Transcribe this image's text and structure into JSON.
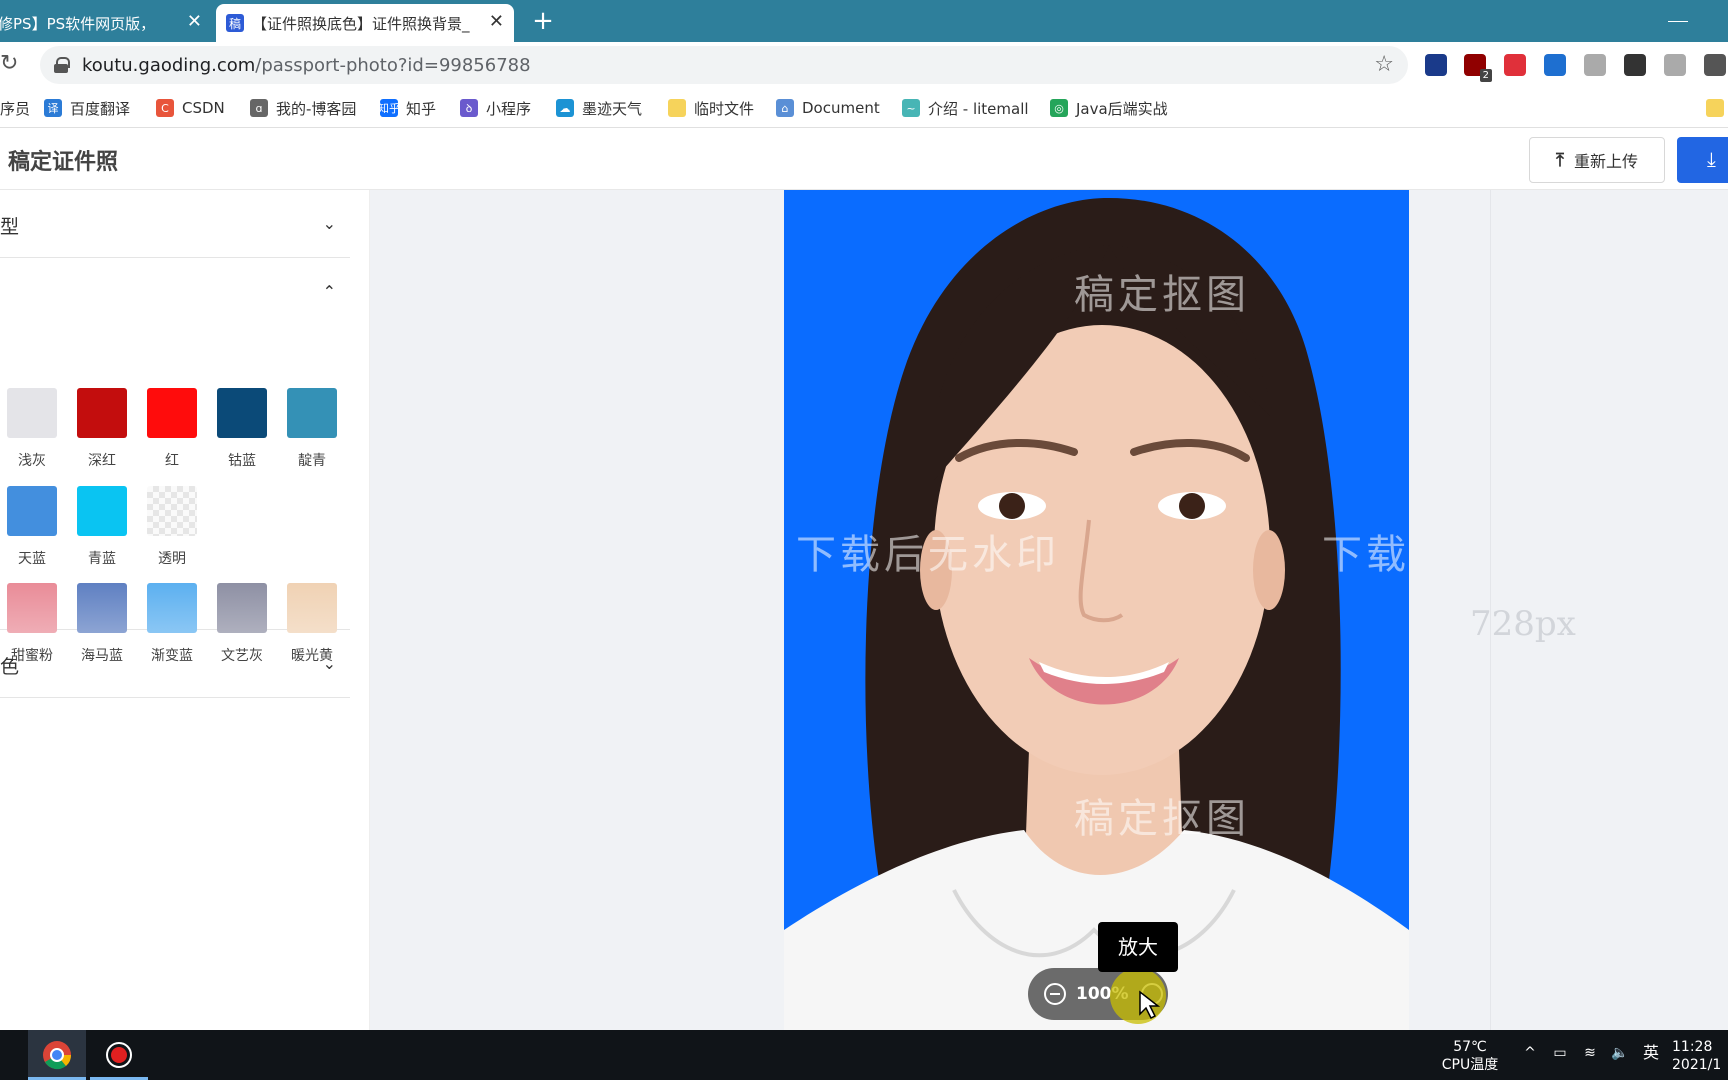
{
  "browser": {
    "tabs": [
      {
        "title": "修PS】PS软件网页版，ps在",
        "active": false
      },
      {
        "title": "【证件照换底色】证件照换背景_",
        "active": true,
        "favicon": "稿"
      }
    ],
    "new_tab": "+",
    "url_host": "koutu.gaoding.com",
    "url_path": "/passport-photo?id=99856788",
    "bookmarks": [
      {
        "label": "序员",
        "icon": "",
        "color": ""
      },
      {
        "label": "百度翻译",
        "icon": "译",
        "color": "#2b7bd6"
      },
      {
        "label": "CSDN",
        "icon": "C",
        "color": "#e8553b"
      },
      {
        "label": "我的-博客园",
        "icon": "ɑ",
        "color": "#666666"
      },
      {
        "label": "知乎",
        "icon": "知乎",
        "color": "#0f6fff"
      },
      {
        "label": "小程序",
        "icon": "ꝺ",
        "color": "#6a5acd"
      },
      {
        "label": "墨迹天气",
        "icon": "☁",
        "color": "#1c93d4"
      },
      {
        "label": "临时文件",
        "icon": "",
        "color": "#f6d35b"
      },
      {
        "label": "Document",
        "icon": "⌂",
        "color": "#5a8fd6"
      },
      {
        "label": "介绍 - litemall",
        "icon": "~",
        "color": "#47b5b5"
      },
      {
        "label": "Java后端实战",
        "icon": "◎",
        "color": "#25a55a"
      }
    ],
    "extensions": [
      {
        "name": "shield-ext-icon",
        "color": "#1a3a8a"
      },
      {
        "name": "ublock-icon",
        "color": "#900000",
        "badge": "2"
      },
      {
        "name": "pair-ext-icon",
        "color": "#e0303a"
      },
      {
        "name": "doc-ext-icon",
        "color": "#1e6fd0"
      },
      {
        "name": "grid-ext-icon",
        "color": "#aaaaaa"
      },
      {
        "name": "json-ext-icon",
        "color": "#333333"
      },
      {
        "name": "check-ext-icon",
        "color": "#aaaaaa"
      },
      {
        "name": "puzzle-icon",
        "color": "#555555"
      }
    ]
  },
  "app": {
    "brand": "稿定证件照",
    "reupload_label": "重新上传",
    "sections": [
      {
        "title": "型",
        "expanded": false
      },
      {
        "title": "",
        "expanded": true
      },
      {
        "title": "色",
        "expanded": false
      }
    ],
    "swatch_rows": [
      [
        {
          "label": "浅灰",
          "color": "#e4e4e8"
        },
        {
          "label": "深红",
          "color": "#c30d0d"
        },
        {
          "label": "红",
          "color": "#ff0c0c"
        },
        {
          "label": "钴蓝",
          "color": "#0b4a78"
        },
        {
          "label": "靛青",
          "color": "#3491b6"
        }
      ],
      [
        {
          "label": "天蓝",
          "color": "#438fde"
        },
        {
          "label": "青蓝",
          "color": "#0ac4f2"
        },
        {
          "label": "透明",
          "color": "transparent"
        }
      ],
      [
        {
          "label": "甜蜜粉",
          "color": "#e98c98"
        },
        {
          "label": "海马蓝",
          "color": "#5f80c2"
        },
        {
          "label": "渐变蓝",
          "color": "#5cb0f0"
        },
        {
          "label": "文艺灰",
          "color": "#8e90a4"
        },
        {
          "label": "暖光黄",
          "color": "#f0d2b4"
        }
      ]
    ],
    "photo_background": "#0a6cff",
    "watermarks": [
      "稿定抠图",
      "下载后无水印",
      "下载后",
      "稿定抠图"
    ],
    "dimension_label": "728px",
    "zoom_value": "100%",
    "tooltip": "放大"
  },
  "taskbar": {
    "temp": "57℃",
    "temp_label": "CPU温度",
    "ime": "英",
    "time": "11:28",
    "date": "2021/1"
  }
}
